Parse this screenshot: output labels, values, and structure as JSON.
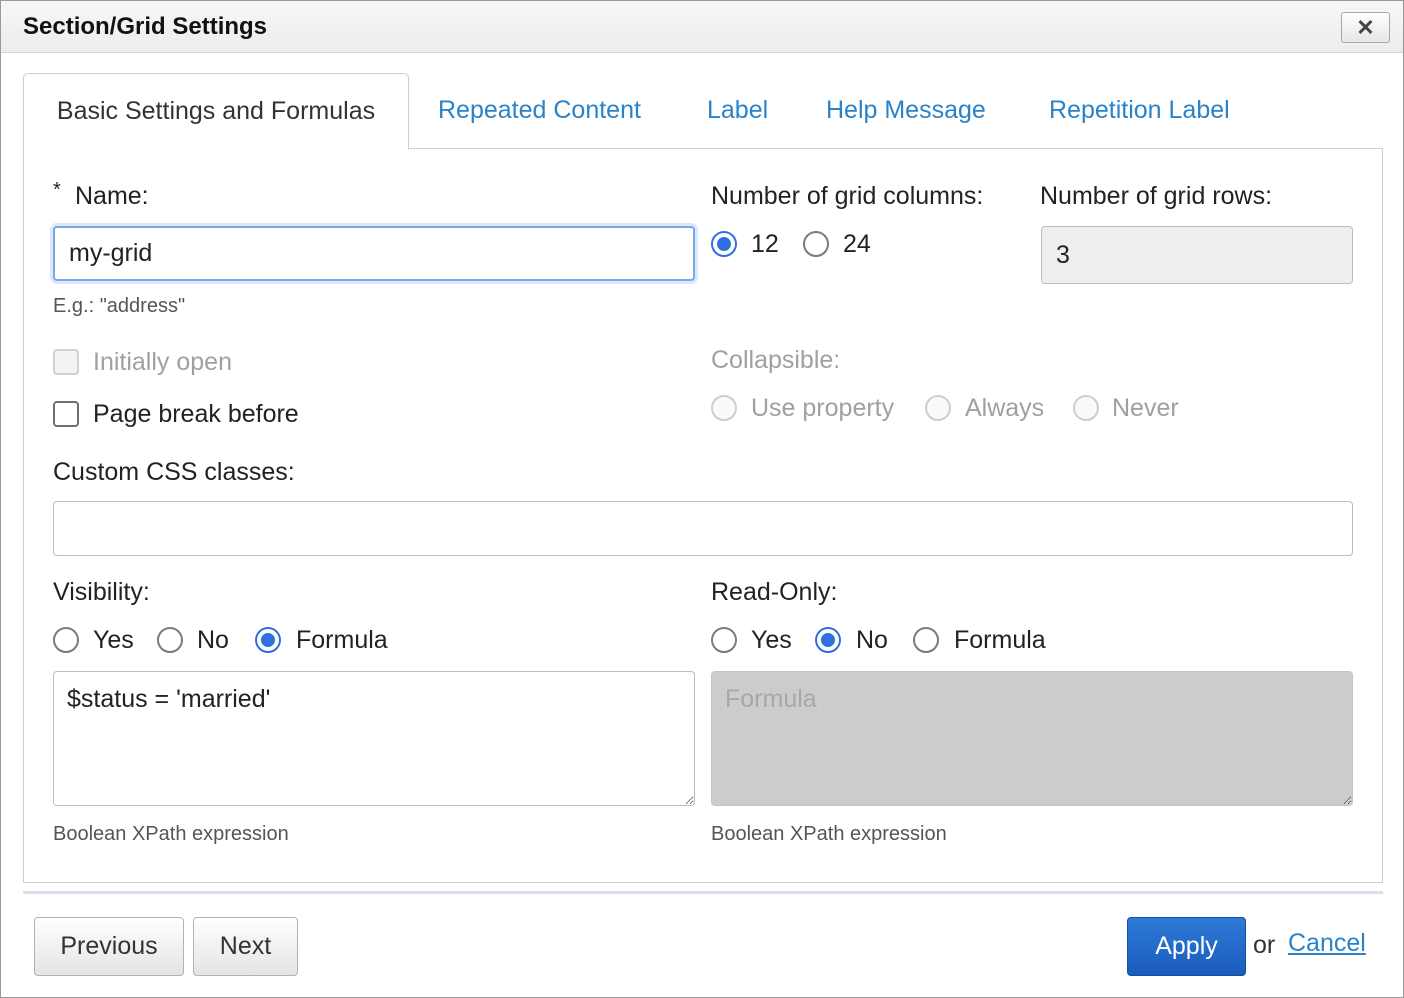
{
  "dialog": {
    "title": "Section/Grid Settings",
    "close_label": "✕"
  },
  "tabs": [
    {
      "label": "Basic Settings and Formulas",
      "active": true
    },
    {
      "label": "Repeated Content",
      "active": false
    },
    {
      "label": "Label",
      "active": false
    },
    {
      "label": "Help Message",
      "active": false
    },
    {
      "label": "Repetition Label",
      "active": false
    }
  ],
  "name_field": {
    "required_mark": "*",
    "label": "Name:",
    "value": "my-grid",
    "hint": "E.g.: \"address\""
  },
  "grid_columns": {
    "label": "Number of grid columns:",
    "options": [
      "12",
      "24"
    ],
    "selected": "12"
  },
  "grid_rows": {
    "label": "Number of grid rows:",
    "value": "3"
  },
  "initially_open": {
    "label": "Initially open",
    "checked": false,
    "disabled": true
  },
  "page_break": {
    "label": "Page break before",
    "checked": false
  },
  "collapsible": {
    "label": "Collapsible:",
    "options": [
      "Use property",
      "Always",
      "Never"
    ],
    "disabled": true
  },
  "css_classes": {
    "label": "Custom CSS classes:",
    "value": ""
  },
  "visibility": {
    "label": "Visibility:",
    "options": [
      "Yes",
      "No",
      "Formula"
    ],
    "selected": "Formula",
    "formula": "$status = 'married'",
    "hint": "Boolean XPath expression"
  },
  "read_only": {
    "label": "Read-Only:",
    "options": [
      "Yes",
      "No",
      "Formula"
    ],
    "selected": "No",
    "placeholder": "Formula",
    "hint": "Boolean XPath expression"
  },
  "footer": {
    "previous_label": "Previous",
    "next_label": "Next",
    "apply_label": "Apply",
    "or_text": "or",
    "cancel_label": "Cancel"
  },
  "colors": {
    "accent": "#2f6fe0",
    "link": "#2a82c9",
    "apply_button": "#1a5cbc"
  }
}
